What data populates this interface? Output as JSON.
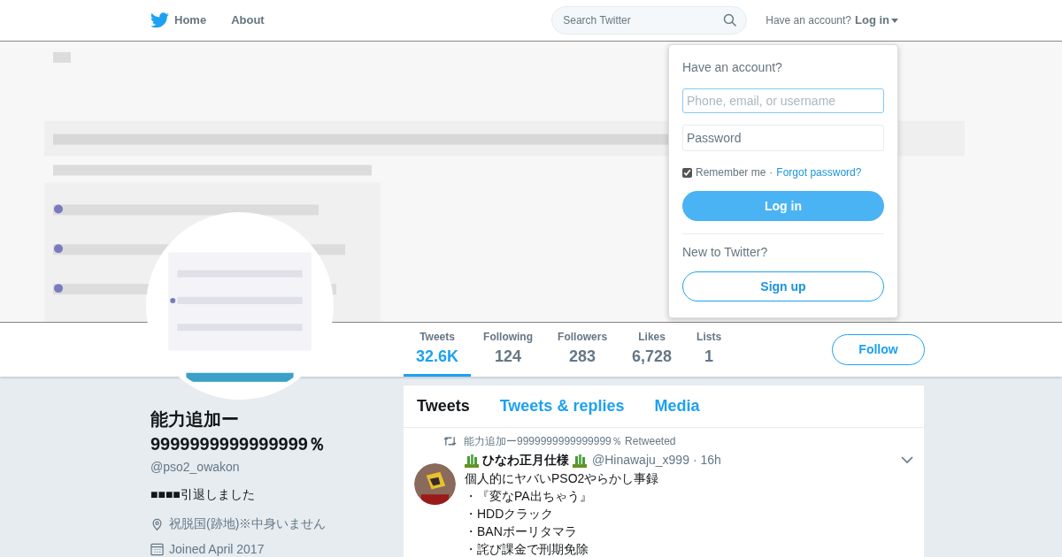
{
  "nav": {
    "items": [
      {
        "label": "Home",
        "kind": "home"
      },
      {
        "label": "About",
        "kind": "link"
      }
    ],
    "search": {
      "placeholder": "Search Twitter"
    },
    "account_prompt": "Have an account?",
    "login_link": "Log in"
  },
  "login_dropdown": {
    "title": "Have an account?",
    "username": {
      "placeholder": "Phone, email, or username"
    },
    "password": {
      "placeholder": "Password"
    },
    "remember": {
      "label": "Remember me",
      "checked": true
    },
    "separator": "·",
    "forgot": "Forgot password?",
    "login_button": "Log in",
    "new_prompt": "New to Twitter?",
    "signup_button": "Sign up"
  },
  "stats": [
    {
      "label": "Tweets",
      "value": "32.6K",
      "selected": true
    },
    {
      "label": "Following",
      "value": "124",
      "selected": false
    },
    {
      "label": "Followers",
      "value": "283",
      "selected": false
    },
    {
      "label": "Likes",
      "value": "6,728",
      "selected": false
    },
    {
      "label": "Lists",
      "value": "1",
      "selected": false
    }
  ],
  "follow_button": "Follow",
  "profile": {
    "name": "能力追加ー9999999999999999％",
    "handle": "@pso2_owakon",
    "bio": "■■■■引退しました",
    "location": "祝脱国(跡地)※中身いません",
    "joined": "Joined April 2017"
  },
  "timeline_tabs": [
    {
      "label": "Tweets",
      "selected": true
    },
    {
      "label": "Tweets & replies",
      "selected": false
    },
    {
      "label": "Media",
      "selected": false
    }
  ],
  "tweets": [
    {
      "retweeted_by": "能力追加ー9999999999999999％ Retweeted",
      "author": "ひなわ正月仕様",
      "handle": "@Hinawaju_x999",
      "time": "· 16h",
      "lines": [
        "個人的にヤバいPSO2やらかし事録",
        "・『変なPA出ちゃう』",
        "・HDDクラック",
        "・BANボーリタマラ",
        "・詫び課金で刑期免除"
      ]
    }
  ]
}
